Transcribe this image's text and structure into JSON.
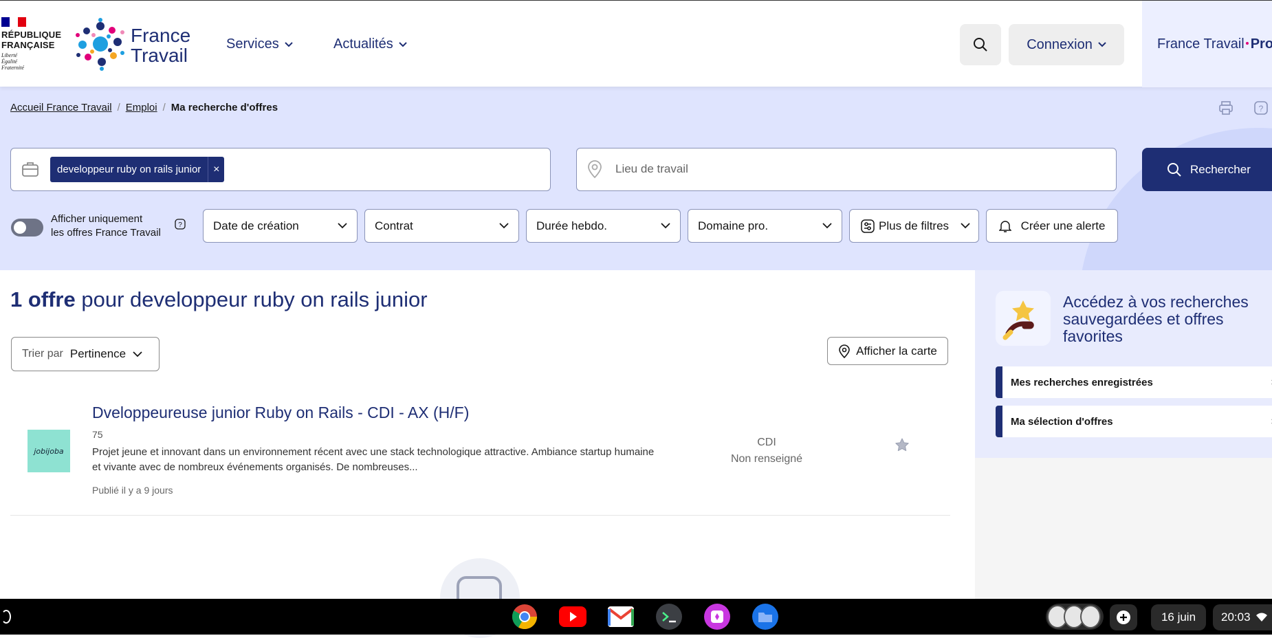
{
  "header": {
    "rf_text": [
      "RÉPUBLIQUE",
      "FRANÇAISE"
    ],
    "rf_devise": [
      "Liberté",
      "Égalité",
      "Fraternité"
    ],
    "brand_line1": "France",
    "brand_line2": "Travail",
    "nav": [
      {
        "label": "Services"
      },
      {
        "label": "Actualités"
      }
    ],
    "connexion_label": "Connexion",
    "pro_label": "France Travail",
    "pro_suffix": "Pro"
  },
  "breadcrumb": {
    "items": [
      "Accueil France Travail",
      "Emploi"
    ],
    "current": "Ma recherche d'offres"
  },
  "search": {
    "keyword_chip": "developpeur ruby on rails junior",
    "chip_remove": "×",
    "location_placeholder": "Lieu de travail",
    "submit_label": "Rechercher"
  },
  "filters": {
    "toggle_label_line1": "Afficher uniquement",
    "toggle_label_line2": "les offres France Travail",
    "dropdowns": [
      "Date de création",
      "Contrat",
      "Durée hebdo.",
      "Domaine pro."
    ],
    "more_filters": "Plus de filtres",
    "alert_label": "Créer une alerte"
  },
  "results": {
    "count_label": "1 offre",
    "query_label": "pour developpeur ruby on rails junior",
    "sort_label": "Trier par",
    "sort_value": "Pertinence",
    "map_button": "Afficher la carte"
  },
  "offers": [
    {
      "title": "Dveloppeureuse junior Ruby on Rails - CDI - AX (H/F)",
      "location": "75",
      "description": "Projet jeune et innovant dans un environnement récent avec une stack technologique attractive. Ambiance startup humaine et vivante avec de nombreux événements organisés. De nombreuses...",
      "published": "Publié il y a 9 jours",
      "contract": "CDI",
      "salary": "Non renseigné",
      "company_logo_text": "jobijoba"
    }
  ],
  "sidebar": {
    "title": "Accédez à vos recherches sauvegardées et offres favorites",
    "links": [
      "Mes recherches enregistrées",
      "Ma sélection d'offres"
    ]
  },
  "taskbar": {
    "date": "16 juin",
    "time": "20:03",
    "apps": [
      "chrome-icon",
      "youtube-icon",
      "gmail-icon",
      "terminal-icon",
      "canvas-icon",
      "files-icon"
    ]
  },
  "colors": {
    "brand_navy": "#1e2e74",
    "band_bg": "#dfe4fe",
    "accent_pink": "#e1007a"
  }
}
